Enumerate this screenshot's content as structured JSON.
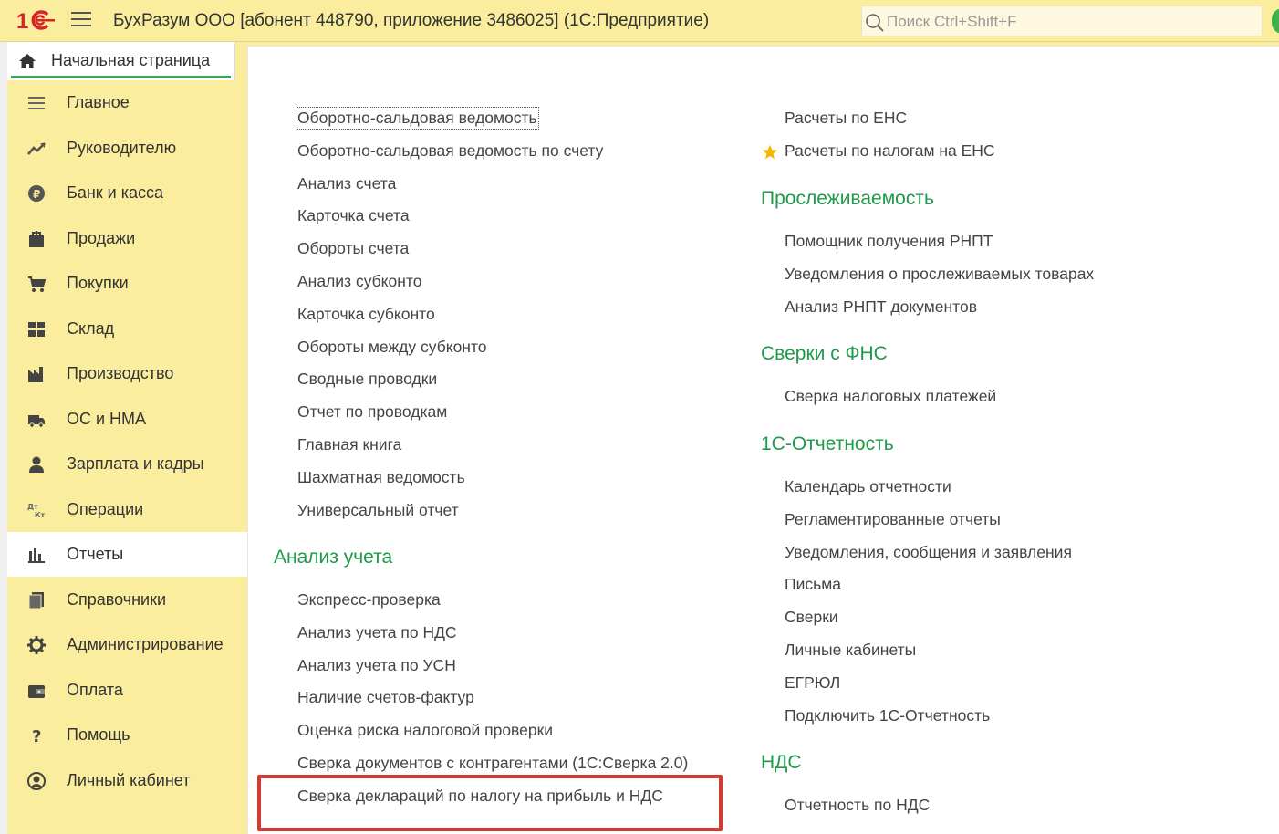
{
  "titlebar": {
    "app_title": "БухРазум ООО [абонент 448790, приложение 3486025]  (1С:Предприятие)",
    "search_placeholder": "Поиск Ctrl+Shift+F"
  },
  "home_tab": {
    "label": "Начальная страница"
  },
  "sidebar": {
    "items": [
      {
        "label": "Главное",
        "icon": "menu-lines-icon"
      },
      {
        "label": "Руководителю",
        "icon": "trend-chart-icon"
      },
      {
        "label": "Банк и касса",
        "icon": "ruble-coin-icon"
      },
      {
        "label": "Продажи",
        "icon": "shopping-bag-icon"
      },
      {
        "label": "Покупки",
        "icon": "cart-icon"
      },
      {
        "label": "Склад",
        "icon": "warehouse-grid-icon"
      },
      {
        "label": "Производство",
        "icon": "factory-icon"
      },
      {
        "label": "ОС и НМА",
        "icon": "truck-icon"
      },
      {
        "label": "Зарплата и кадры",
        "icon": "person-icon"
      },
      {
        "label": "Операции",
        "icon": "dt-kt-icon"
      },
      {
        "label": "Отчеты",
        "icon": "bar-chart-icon"
      },
      {
        "label": "Справочники",
        "icon": "books-icon"
      },
      {
        "label": "Администрирование",
        "icon": "gear-icon"
      },
      {
        "label": "Оплата",
        "icon": "wallet-icon"
      },
      {
        "label": "Помощь",
        "icon": "question-icon"
      },
      {
        "label": "Личный кабинет",
        "icon": "user-circle-icon"
      }
    ],
    "active_index": 10
  },
  "left_column": {
    "links": [
      "Оборотно-сальдовая ведомость",
      "Оборотно-сальдовая ведомость по счету",
      "Анализ счета",
      "Карточка счета",
      "Обороты счета",
      "Анализ субконто",
      "Карточка субконто",
      "Обороты между субконто",
      "Сводные проводки",
      "Отчет по проводкам",
      "Главная книга",
      "Шахматная ведомость",
      "Универсальный отчет"
    ],
    "analysis": {
      "heading": "Анализ учета",
      "links": [
        "Экспресс-проверка",
        "Анализ учета по НДС",
        "Анализ учета по УСН",
        "Наличие счетов-фактур",
        "Оценка риска налоговой проверки",
        "Сверка документов с контрагентами (1С:Сверка 2.0)",
        "Сверка деклараций по налогу на прибыль и НДС"
      ]
    }
  },
  "right_column": {
    "ens_links": [
      "Расчеты по ЕНС",
      "Расчеты по налогам на ЕНС"
    ],
    "traceability": {
      "heading": "Прослеживаемость",
      "links": [
        "Помощник получения РНПТ",
        "Уведомления о прослеживаемых товарах",
        "Анализ РНПТ документов"
      ]
    },
    "fns": {
      "heading": "Сверки с ФНС",
      "links": [
        "Сверка налоговых платежей"
      ]
    },
    "reporting": {
      "heading": "1С-Отчетность",
      "links": [
        "Календарь отчетности",
        "Регламентированные отчеты",
        "Уведомления, сообщения и заявления",
        "Письма",
        "Сверки",
        "Личные кабинеты",
        "ЕГРЮЛ",
        "Подключить 1С-Отчетность"
      ]
    },
    "vat": {
      "heading": "НДС",
      "links": [
        "Отчетность по НДС"
      ]
    }
  },
  "colors": {
    "panel": "#fbed9e",
    "heading": "#1e9a4a",
    "highlight_box": "#d23a33"
  }
}
